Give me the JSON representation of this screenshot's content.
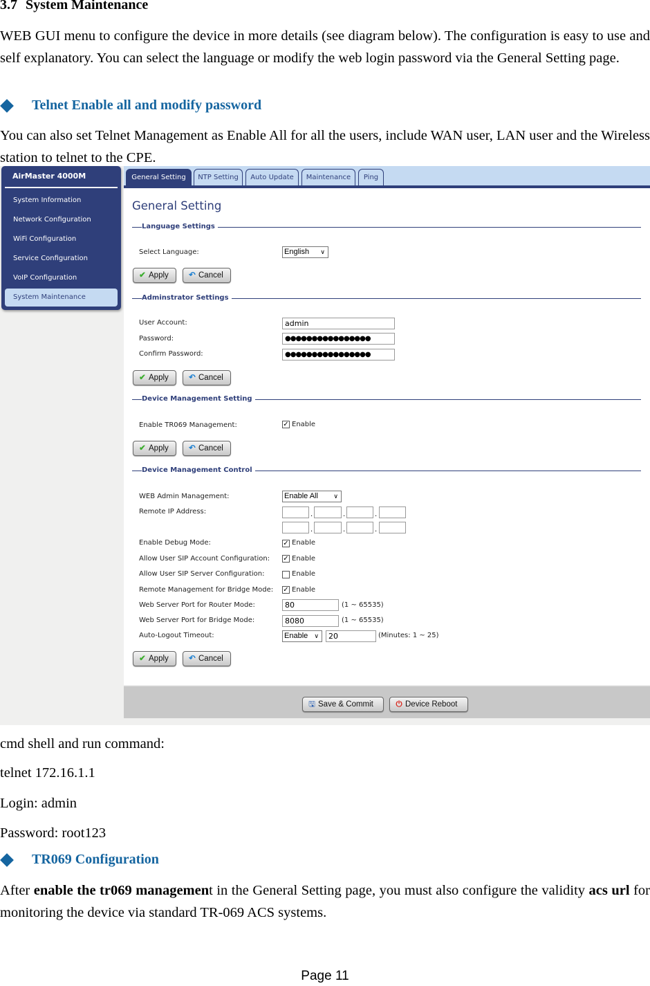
{
  "document": {
    "section_number": "3.7",
    "section_title": "System Maintenance",
    "intro_text": "WEB GUI menu to configure the device in more details (see diagram below). The configuration is easy to use and self explanatory.  You can select the language or modify the web login password via the General Setting page.",
    "bullet1": "Telnet Enable all and modify password",
    "telnet_text": "You can also set Telnet Management as Enable All for all the users, include WAN user, LAN user and the Wireless station to telnet to the CPE.",
    "cmd_line": "cmd shell and run command:",
    "telnet_cmd": "telnet 172.16.1.1",
    "login_line": "Login: admin",
    "password_line": "Password: root123",
    "bullet2": "TR069 Configuration",
    "tr069_text_pre": "After ",
    "tr069_text_bold1": "enable the tr069 managemen",
    "tr069_text_mid": "t in the General Setting page, you must also configure the validity ",
    "tr069_text_bold2": "acs url",
    "tr069_text_post": " for monitoring the device via standard TR-069 ACS systems.",
    "page_label": "Page 11"
  },
  "screenshot": {
    "sidebar": {
      "title": "AirMaster 4000M",
      "items": [
        {
          "label": "System Information"
        },
        {
          "label": "Network Configuration"
        },
        {
          "label": "WiFi Configuration"
        },
        {
          "label": "Service Configuration"
        },
        {
          "label": "VoIP Configuration"
        },
        {
          "label": "System Maintenance",
          "active": true
        }
      ]
    },
    "tabs": [
      {
        "label": "General Setting",
        "active": true
      },
      {
        "label": "NTP Setting"
      },
      {
        "label": "Auto Update"
      },
      {
        "label": "Maintenance"
      },
      {
        "label": "Ping"
      }
    ],
    "page_title": "General Setting",
    "buttons": {
      "apply": "Apply",
      "cancel": "Cancel",
      "save_commit": "Save & Commit",
      "device_reboot": "Device Reboot"
    },
    "language": {
      "section": "Language Settings",
      "select_label": "Select Language:",
      "selected": "English"
    },
    "admin": {
      "section": "Adminstrator Settings",
      "user_label": "User Account:",
      "user_value": "admin",
      "password_label": "Password:",
      "password_value": "●●●●●●●●●●●●●●●●",
      "confirm_label": "Confirm Password:",
      "confirm_value": "●●●●●●●●●●●●●●●●"
    },
    "dm_setting": {
      "section": "Device Management Setting",
      "tr069_label": "Enable TR069 Management:",
      "tr069_checked": true,
      "enable_text": "Enable"
    },
    "dm_control": {
      "section": "Device Management Control",
      "web_admin_label": "WEB Admin Management:",
      "web_admin_selected": "Enable All",
      "remote_ip_label": "Remote IP Address:",
      "remote_ip_1": [
        "",
        "",
        "",
        ""
      ],
      "remote_ip_2": [
        "",
        "",
        "",
        ""
      ],
      "enable_text": "Enable",
      "checkboxes": [
        {
          "label": "Enable Debug Mode:",
          "checked": true
        },
        {
          "label": "Allow User SIP Account Configuration:",
          "checked": true
        },
        {
          "label": "Allow User SIP Server Configuration:",
          "checked": false
        },
        {
          "label": "Remote Management for Bridge Mode:",
          "checked": true
        }
      ],
      "router_port_label": "Web Server Port for Router Mode:",
      "router_port_value": "80",
      "router_port_hint": "(1 ~ 65535)",
      "bridge_port_label": "Web Server Port for Bridge Mode:",
      "bridge_port_value": "8080",
      "bridge_port_hint": "(1 ~ 65535)",
      "autologout_label": "Auto-Logout Timeout:",
      "autologout_selected": "Enable",
      "autologout_value": "20",
      "autologout_hint": "(Minutes: 1 ~ 25)"
    }
  }
}
